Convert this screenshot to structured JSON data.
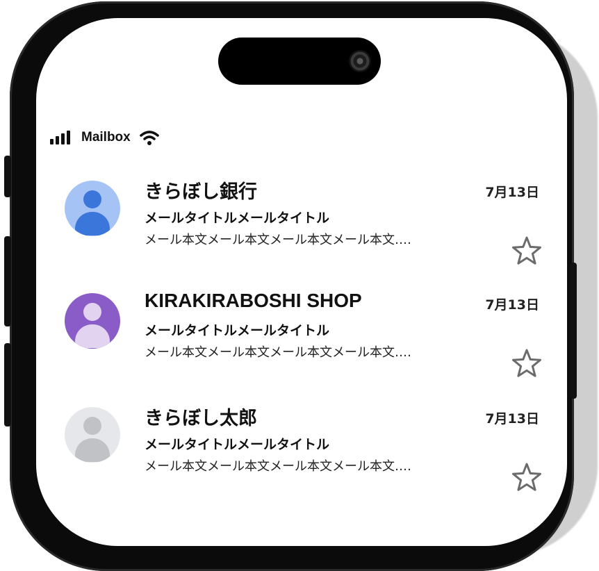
{
  "status_bar": {
    "title": "Mailbox",
    "signal_icon": "cellular-signal-icon",
    "wifi_icon": "wifi-icon"
  },
  "mails": [
    {
      "sender": "きらぼし銀行",
      "date": "7月13日",
      "subject": "メールタイトルメールタイトル",
      "preview": "メール本文メール本文メール本文メール本文‥‥",
      "avatar_bg": "#a6c3f5",
      "avatar_fg": "#3b77db",
      "starred": false
    },
    {
      "sender": "KIRAKIRABOSHI SHOP",
      "date": "7月13日",
      "subject": "メールタイトルメールタイトル",
      "preview": "メール本文メール本文メール本文メール本文‥‥",
      "avatar_bg": "#8a5cc7",
      "avatar_fg": "#e2d3f0",
      "starred": false
    },
    {
      "sender": "きらぼし太郎",
      "date": "7月13日",
      "subject": "メールタイトルメールタイトル",
      "preview": "メール本文メール本文メール本文メール本文‥‥",
      "avatar_bg": "#e6e7ea",
      "avatar_fg": "#c1c2c6",
      "starred": false
    }
  ]
}
